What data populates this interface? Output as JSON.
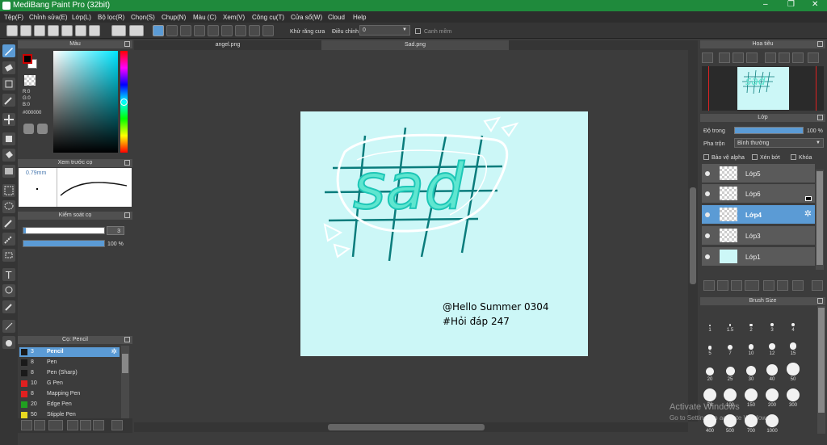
{
  "window": {
    "title": "MediBang Paint Pro (32bit)"
  },
  "menu": [
    "Tệp(F)",
    "Chỉnh sửa(E)",
    "Lớp(L)",
    "Bộ lọc(R)",
    "Chọn(S)",
    "Chụp(N)",
    "Màu (C)",
    "Xem(V)",
    "Công cụ(T)",
    "Cửa sổ(W)",
    "Cloud",
    "Help"
  ],
  "toolbar": {
    "antialias_label": "Khử răng cưa",
    "adjust_label": "Điều chỉnh",
    "adjust_value": "0",
    "smooth_label": "Canh mềm"
  },
  "color_panel": {
    "title": "Màu",
    "r": "R:0",
    "g": "G:0",
    "b": "B:0",
    "hex": "#000000"
  },
  "brush_preview": {
    "title": "Xem trước cọ",
    "size": "0.79mm"
  },
  "brush_control": {
    "title": "Kiểm soát cọ",
    "size_value": "3",
    "opacity_value": "100 %",
    "size_fraction": 0.03,
    "opacity_fraction": 1.0
  },
  "brush_list": {
    "title": "Cọ: Pencil",
    "items": [
      {
        "size": "3",
        "name": "Pencil",
        "color": "#1a1a1a",
        "selected": true
      },
      {
        "size": "8",
        "name": "Pen",
        "color": "#1a1a1a"
      },
      {
        "size": "8",
        "name": "Pen (Sharp)",
        "color": "#1a1a1a"
      },
      {
        "size": "10",
        "name": "G Pen",
        "color": "#e02020"
      },
      {
        "size": "8",
        "name": "Mapping Pen",
        "color": "#e02020"
      },
      {
        "size": "20",
        "name": "Edge Pen",
        "color": "#20a020"
      },
      {
        "size": "50",
        "name": "Stipple Pen",
        "color": "#e8d820"
      }
    ]
  },
  "tabs": [
    "angel.png",
    "Sad.png"
  ],
  "canvas": {
    "title_word": "sad",
    "caption_line1": "@Hello Summer 0304",
    "caption_line2": "#Hỏi đáp 247",
    "bg": "#ccf7f7"
  },
  "navigator": {
    "title": "Hoa tiêu"
  },
  "layers_panel": {
    "title": "Lớp",
    "opacity_label": "Độ trong",
    "opacity_value": "100 %",
    "blend_label": "Pha trộn",
    "blend_value": "Bình thường",
    "protect_alpha": "Bảo vệ alpha",
    "clipping": "Xén bớt",
    "lock": "Khóa",
    "layers": [
      {
        "name": "Lớp5"
      },
      {
        "name": "Lớp6"
      },
      {
        "name": "Lớp4",
        "selected": true
      },
      {
        "name": "Lớp3"
      },
      {
        "name": "Lớp1"
      }
    ]
  },
  "brush_size": {
    "title": "Brush Size",
    "rows": [
      [
        "1",
        "1.5",
        "2",
        "3",
        "4"
      ],
      [
        "5",
        "7",
        "10",
        "12",
        "15"
      ],
      [
        "20",
        "25",
        "30",
        "40",
        "50"
      ],
      [
        "70",
        "100",
        "150",
        "200",
        "300"
      ],
      [
        "400",
        "500",
        "700",
        "1000"
      ]
    ]
  },
  "watermark": {
    "line1": "Activate Windows",
    "line2": "Go to Settings to activate Windows."
  }
}
